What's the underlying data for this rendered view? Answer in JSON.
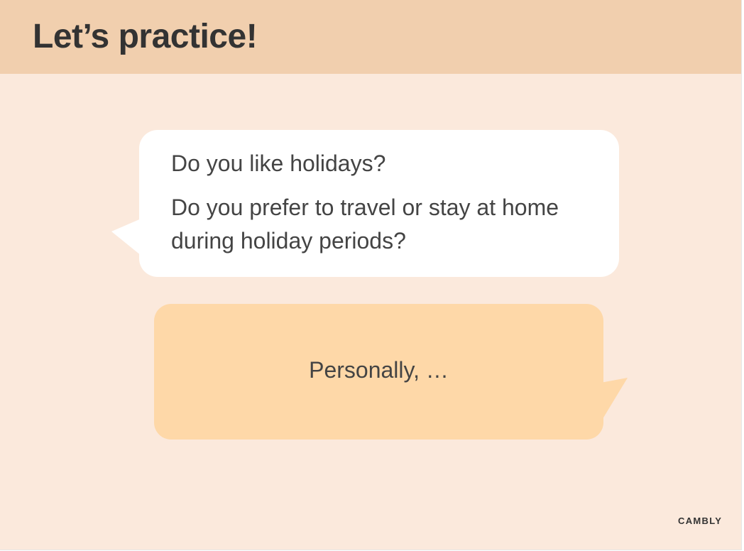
{
  "header": {
    "title": "Let’s practice!"
  },
  "question_bubble": {
    "line_1": "Do you like holidays?",
    "line_2": "Do you prefer to travel or stay at home during holiday periods?"
  },
  "answer_bubble": {
    "text": "Personally, …"
  },
  "branding": {
    "logo_text": "CAMBLY"
  },
  "colors": {
    "background": "#fbe9dc",
    "header": "#f1cfae",
    "question_bubble": "#ffffff",
    "answer_bubble": "#fed8a8",
    "text": "#444444"
  }
}
